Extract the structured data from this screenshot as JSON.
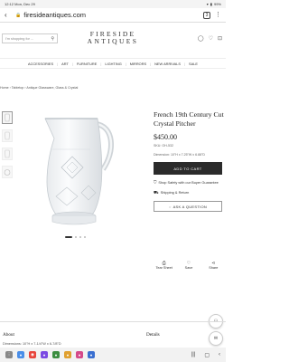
{
  "status_bar": {
    "time": "12:12",
    "date": "Mon, Dec 29",
    "battery": "99%"
  },
  "browser": {
    "url": "firesideantiques.com"
  },
  "header": {
    "search_placeholder": "I'm shopping for ...",
    "logo_line1": "FIRESIDE",
    "logo_line2": "ANTIQUES"
  },
  "nav": {
    "items": [
      "ACCESSORIES",
      "ART",
      "FURNITURE",
      "LIGHTING",
      "MIRRORS",
      "NEW ARRIVALS",
      "SALE"
    ]
  },
  "breadcrumb": [
    "Home",
    "Tabletop",
    "Antique Glassware, Glass & Crystal"
  ],
  "product": {
    "title": "French 19th Century Cut Crystal Pitcher",
    "price": "$450.00",
    "sku": "SKU: OH-532",
    "dimensions": "Dimension: 10\"H x 7.25\"W x 6.88\"D",
    "add_to_cart": "ADD TO CART",
    "shop_safely": "Shop Safely with our Buyer Guarantee",
    "shipping": "Shipping & Return",
    "ask": "ASK A QUESTION"
  },
  "actions": {
    "tear_sheet": "Tear Sheet",
    "save": "Save",
    "share": "Share"
  },
  "sections": {
    "about": "About",
    "about_dims": "Dimensions: 10\"H x 7-1/4\"W x 6-7/8\"D",
    "details": "Details"
  },
  "icons": {
    "accent": "#2b2b2b"
  }
}
